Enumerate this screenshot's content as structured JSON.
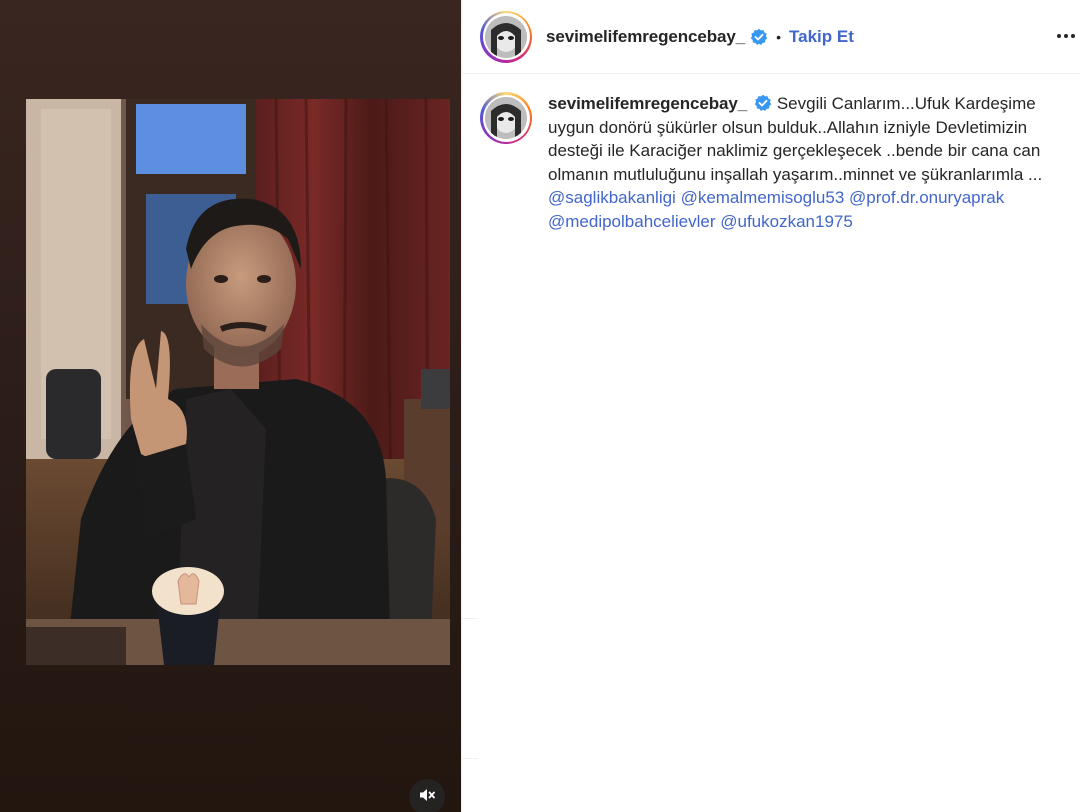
{
  "post": {
    "username": "sevimelifemregencebay_",
    "follow_label": "Takip Et",
    "header_separator": "•",
    "caption_text": "Sevgili Canlarım...Ufuk Kardeşime uygun donörü şükürler olsun bulduk..Allahın izniyle Devletimizin desteği ile Karaciğer naklimiz gerçekleşecek ..bende bir cana can olmanın mutluluğunu inşallah yaşarım..minnet ve şükranlarımla ...",
    "mentions": [
      "@saglikbakanligi",
      "@kemalmemisoglu53",
      "@prof.dr.onuryaprak",
      "@medipolbahcelievler",
      "@ufukozkan1975"
    ],
    "verified_icon": "verified-badge-icon",
    "more_icon": "more-options-icon",
    "mute_icon": "speaker-muted-icon"
  },
  "colors": {
    "accent": "#4266cc",
    "verified": "#3897f0",
    "media_background": "#2b1c18"
  }
}
